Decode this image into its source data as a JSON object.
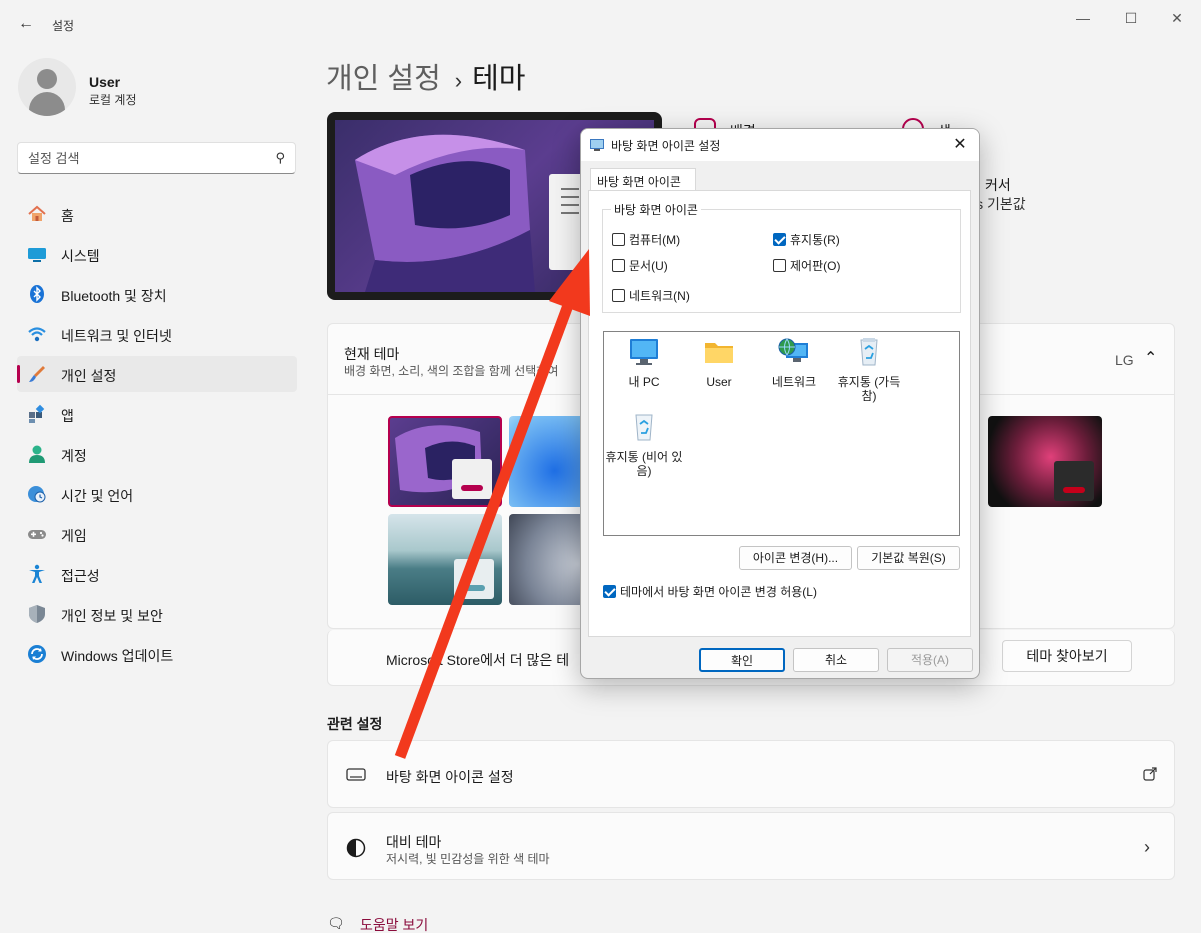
{
  "window": {
    "title": "설정",
    "back_icon": "back-arrow-icon"
  },
  "user": {
    "name": "User",
    "account_type": "로컬 계정"
  },
  "search": {
    "placeholder": "설정 검색"
  },
  "sidebar": {
    "items": [
      {
        "label": "홈",
        "icon": "home-icon",
        "active": false
      },
      {
        "label": "시스템",
        "icon": "system-icon",
        "active": false
      },
      {
        "label": "Bluetooth 및 장치",
        "icon": "bluetooth-icon",
        "active": false
      },
      {
        "label": "네트워크 및 인터넷",
        "icon": "wifi-icon",
        "active": false
      },
      {
        "label": "개인 설정",
        "icon": "brush-icon",
        "active": true
      },
      {
        "label": "앱",
        "icon": "apps-icon",
        "active": false
      },
      {
        "label": "계정",
        "icon": "account-icon",
        "active": false
      },
      {
        "label": "시간 및 언어",
        "icon": "clock-globe-icon",
        "active": false
      },
      {
        "label": "게임",
        "icon": "gamepad-icon",
        "active": false
      },
      {
        "label": "접근성",
        "icon": "accessibility-icon",
        "active": false
      },
      {
        "label": "개인 정보 및 보안",
        "icon": "shield-icon",
        "active": false
      },
      {
        "label": "Windows 업데이트",
        "icon": "update-icon",
        "active": false
      }
    ]
  },
  "breadcrumb": {
    "parent": "개인 설정",
    "separator": "›",
    "current": "테마"
  },
  "theme_props": {
    "background_label": "배경",
    "color_label": "색",
    "cursor_label": "커서",
    "cursor_value": "ws 기본값"
  },
  "current_theme": {
    "title": "현재 테마",
    "description": "배경 화면, 소리, 색의 조합을 함께 선택하여",
    "value": "LG",
    "store_text": "Microsoft Store에서 더 많은 테",
    "browse_button": "테마 찾아보기"
  },
  "related": {
    "heading": "관련 설정",
    "desktop_icons": "바탕 화면 아이콘 설정",
    "contrast_title": "대비 테마",
    "contrast_desc": "저시력, 빛 민감성을 위한 색 테마"
  },
  "help": {
    "label": "도움말 보기"
  },
  "dialog": {
    "title": "바탕 화면 아이콘 설정",
    "tab": "바탕 화면 아이콘",
    "group_label": "바탕 화면 아이콘",
    "checkboxes": [
      {
        "label": "컴퓨터(M)",
        "checked": false
      },
      {
        "label": "휴지통(R)",
        "checked": true
      },
      {
        "label": "문서(U)",
        "checked": false
      },
      {
        "label": "제어판(O)",
        "checked": false
      },
      {
        "label": "네트워크(N)",
        "checked": false
      }
    ],
    "icons": [
      {
        "label": "내 PC",
        "icon": "monitor-icon"
      },
      {
        "label": "User",
        "icon": "folder-icon"
      },
      {
        "label": "네트워크",
        "icon": "network-globe-icon"
      },
      {
        "label": "휴지통 (가득 참)",
        "icon": "recycle-bin-full-icon"
      },
      {
        "label": "휴지통 (비어 있음)",
        "icon": "recycle-bin-empty-icon"
      }
    ],
    "change_icon_button": "아이콘 변경(H)...",
    "restore_default_button": "기본값 복원(S)",
    "allow_themes_label": "테마에서 바탕 화면 아이콘 변경 허용(L)",
    "allow_themes_checked": true,
    "ok_button": "확인",
    "cancel_button": "취소",
    "apply_button": "적용(A)"
  },
  "colors": {
    "accent": "#b5004e",
    "selection": "#0067c0",
    "annotation_arrow": "#f2391d"
  }
}
